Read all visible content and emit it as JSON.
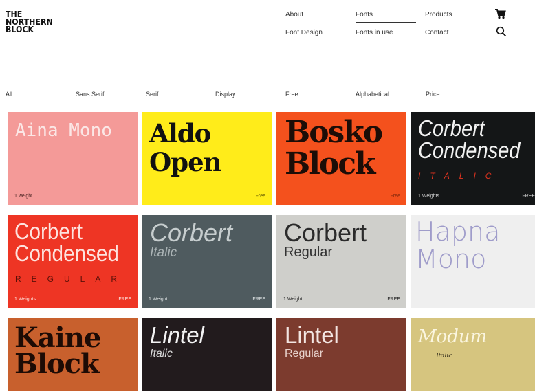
{
  "logo": {
    "lines": [
      "THE",
      "NORTHERN",
      "BLOCK"
    ]
  },
  "nav": {
    "about": "About",
    "fonts": "Fonts",
    "products": "Products",
    "font_design": "Font Design",
    "fonts_in_use": "Fonts in use",
    "contact": "Contact"
  },
  "icons": {
    "cart": "cart-icon",
    "search": "search-icon"
  },
  "filters": [
    "All",
    "Sans Serif",
    "Serif",
    "Display",
    "Free",
    "Alphabetical",
    "Price"
  ],
  "tiles": [
    {
      "line1": "Aina Mono",
      "weights": "1 weight",
      "badge": "",
      "bg": "#f49a98"
    },
    {
      "line1": "Aldo",
      "line2": "Open",
      "weights": "",
      "badge": "Free",
      "bg": "#ffec1a"
    },
    {
      "line1": "Bosko",
      "line2": "Block",
      "weights": "",
      "badge": "Free",
      "bg": "#f4511d"
    },
    {
      "line1": "Corbert",
      "line2": "Condensed",
      "style": "ITALIC",
      "weights": "1 Weights",
      "badge": "FREE",
      "bg": "#141617"
    },
    {
      "line1": "Corbert",
      "line2": "Condensed",
      "style": "REGULAR",
      "weights": "1 Weights",
      "badge": "FREE",
      "bg": "#ee3524"
    },
    {
      "line1": "Corbert",
      "line2": "Italic",
      "weights": "1 Weight",
      "badge": "FREE",
      "bg": "#4f5b5f"
    },
    {
      "line1": "Corbert",
      "line2": "Regular",
      "weights": "1 Weight",
      "badge": "FREE",
      "bg": "#cfcfcb"
    },
    {
      "line1": "Hapna",
      "line2": "Mono",
      "weights": "",
      "badge": "",
      "bg": "#efefef"
    },
    {
      "line1": "Kaine",
      "line2": "Block",
      "bg": "#c8602d"
    },
    {
      "line1": "Lintel",
      "line2": "Italic",
      "bg": "#221b1d"
    },
    {
      "line1": "Lintel",
      "line2": "Regular",
      "bg": "#7c3b2e"
    },
    {
      "line1": "Modum",
      "line2": "Italic",
      "bg": "#d6c57f"
    }
  ]
}
